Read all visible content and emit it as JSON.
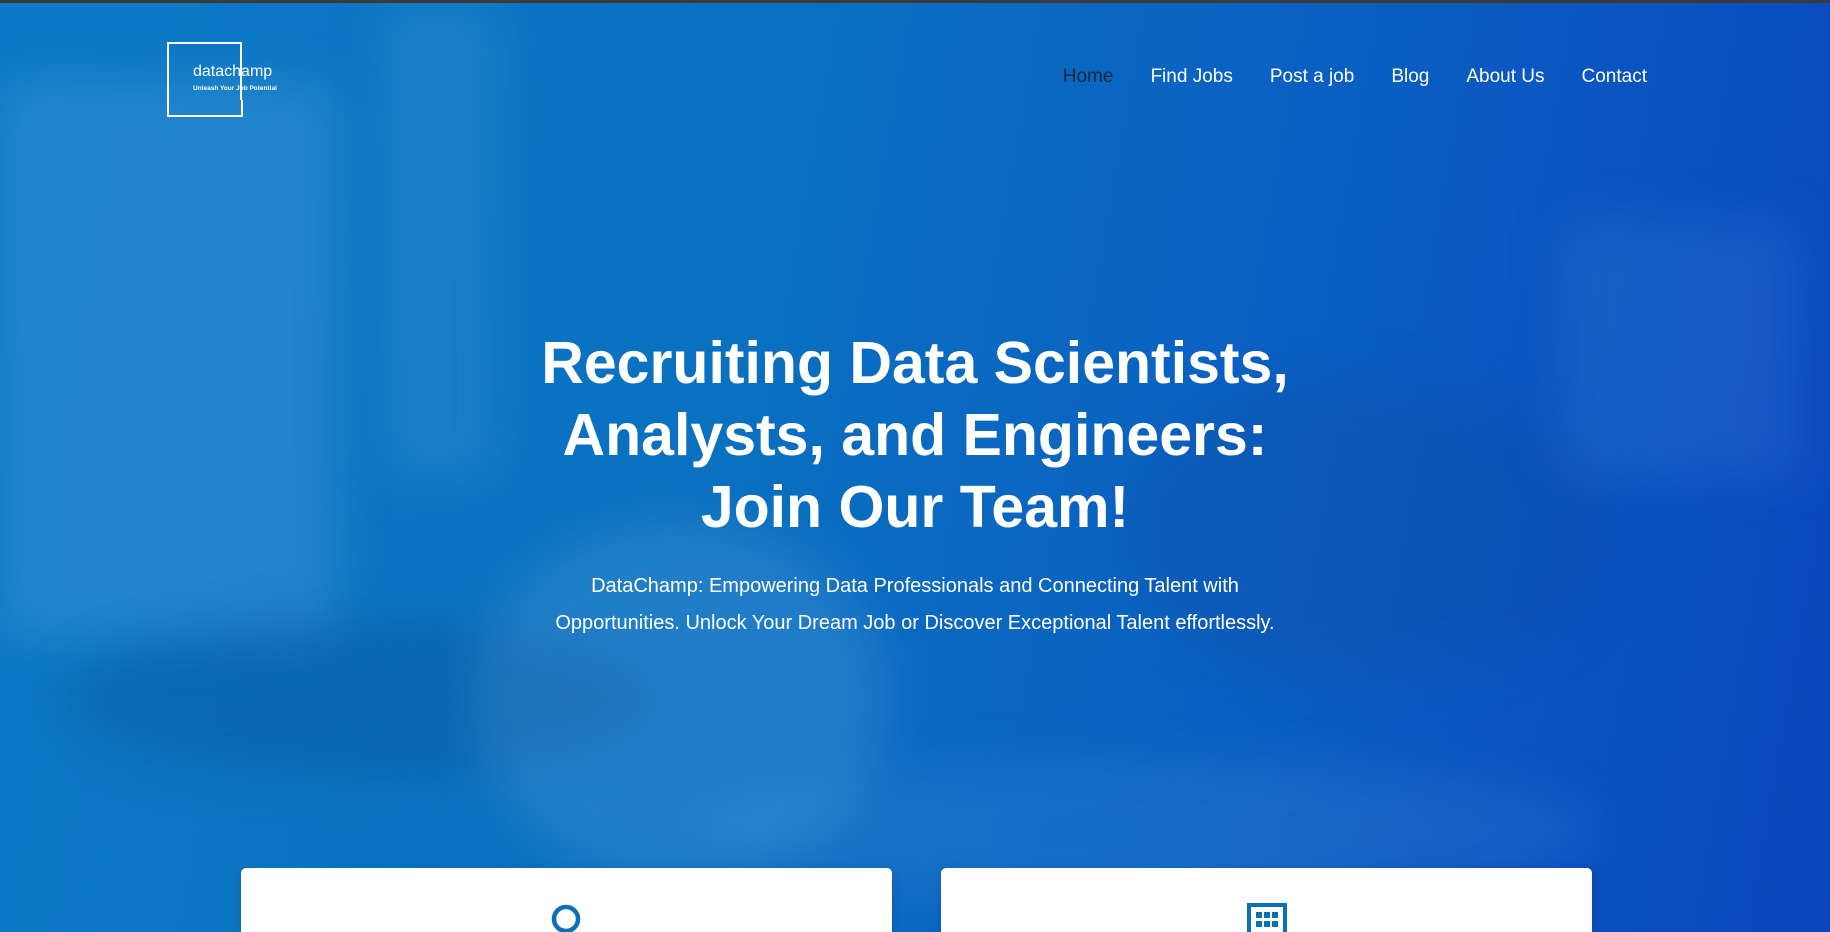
{
  "brand": {
    "name": "datachamp",
    "tagline": "Unleash Your Job Potential"
  },
  "nav": {
    "items": [
      {
        "label": "Home",
        "active": true
      },
      {
        "label": "Find Jobs",
        "active": false
      },
      {
        "label": "Post a job",
        "active": false
      },
      {
        "label": "Blog",
        "active": false
      },
      {
        "label": "About Us",
        "active": false
      },
      {
        "label": "Contact",
        "active": false
      }
    ]
  },
  "hero": {
    "headline_lines": [
      "Recruiting Data Scientists,",
      "Analysts, and Engineers:",
      "Join Our Team!"
    ],
    "subtext_lines": [
      "DataChamp: Empowering Data Professionals and Connecting Talent with",
      "Opportunities. Unlock Your Dream Job or Discover Exceptional Talent effortlessly."
    ]
  },
  "cards": [
    {
      "icon": "circle-icon"
    },
    {
      "icon": "building-icon"
    }
  ],
  "colors": {
    "accent": "#0a6bbb",
    "nav_active": "#1b2838",
    "text": "#ffffff"
  }
}
